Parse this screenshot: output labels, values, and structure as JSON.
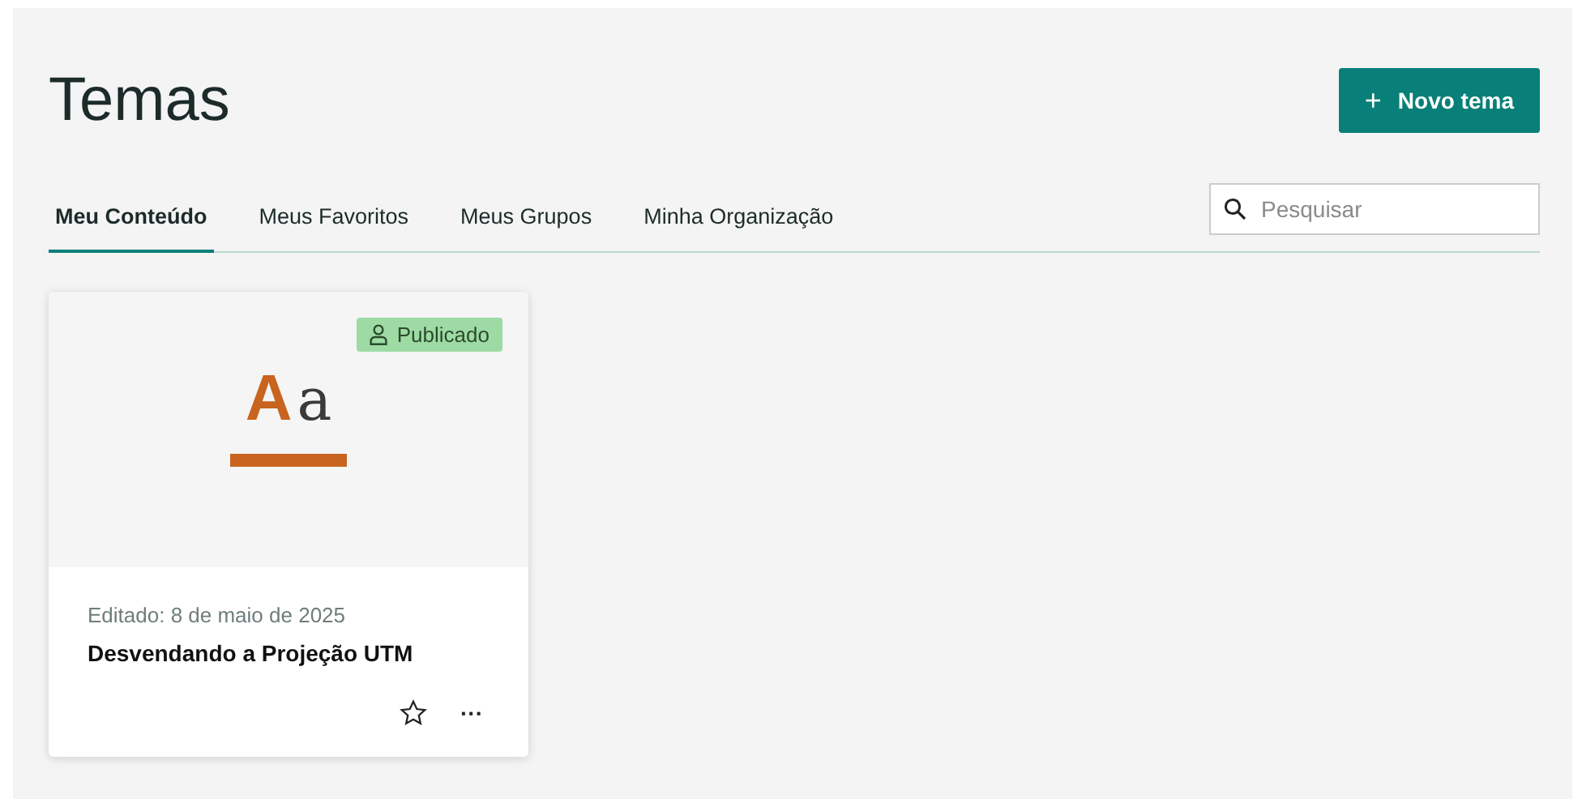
{
  "page": {
    "title": "Temas",
    "new_button": {
      "icon": "+",
      "label": "Novo tema"
    }
  },
  "tabs": [
    {
      "label": "Meu Conteúdo",
      "selected": true
    },
    {
      "label": "Meus Favoritos",
      "selected": false
    },
    {
      "label": "Meus Grupos",
      "selected": false
    },
    {
      "label": "Minha Organização",
      "selected": false
    }
  ],
  "search": {
    "placeholder": "Pesquisar"
  },
  "cards": [
    {
      "thumbnail": {
        "big_letter": "A",
        "small_letter": "a"
      },
      "badge": "Publicado",
      "edited": "Editado: 8 de maio de 2025",
      "title": "Desvendando a Projeção UTM",
      "favorite": false,
      "more": "···"
    }
  ]
}
